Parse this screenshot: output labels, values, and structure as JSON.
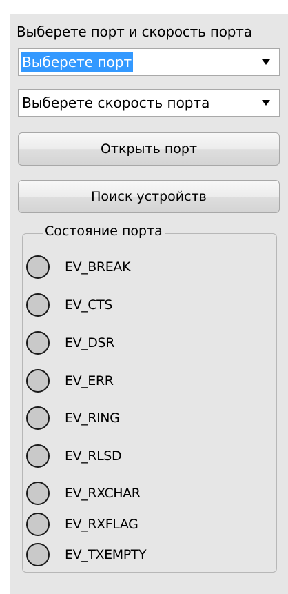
{
  "header": {
    "title": "Выберете порт и скорость порта"
  },
  "port_select": {
    "value": "Выберете порт",
    "arrow_icon": "dropdown-arrow-icon"
  },
  "speed_select": {
    "value": "Выберете скорость порта",
    "arrow_icon": "dropdown-arrow-icon"
  },
  "buttons": {
    "open_port": "Открыть порт",
    "search_devices": "Поиск устройств"
  },
  "port_status": {
    "label": "Состояние порта",
    "indicator_color": "#c9c9c9",
    "events": [
      "EV_BREAK",
      "EV_CTS",
      "EV_DSR",
      "EV_ERR",
      "EV_RING",
      "EV_RLSD",
      "EV_RXCHAR",
      "EV_RXFLAG",
      "EV_TXEMPTY"
    ]
  },
  "colors": {
    "selection": "#3399ff",
    "panel_bg": "#e6e6e6"
  }
}
